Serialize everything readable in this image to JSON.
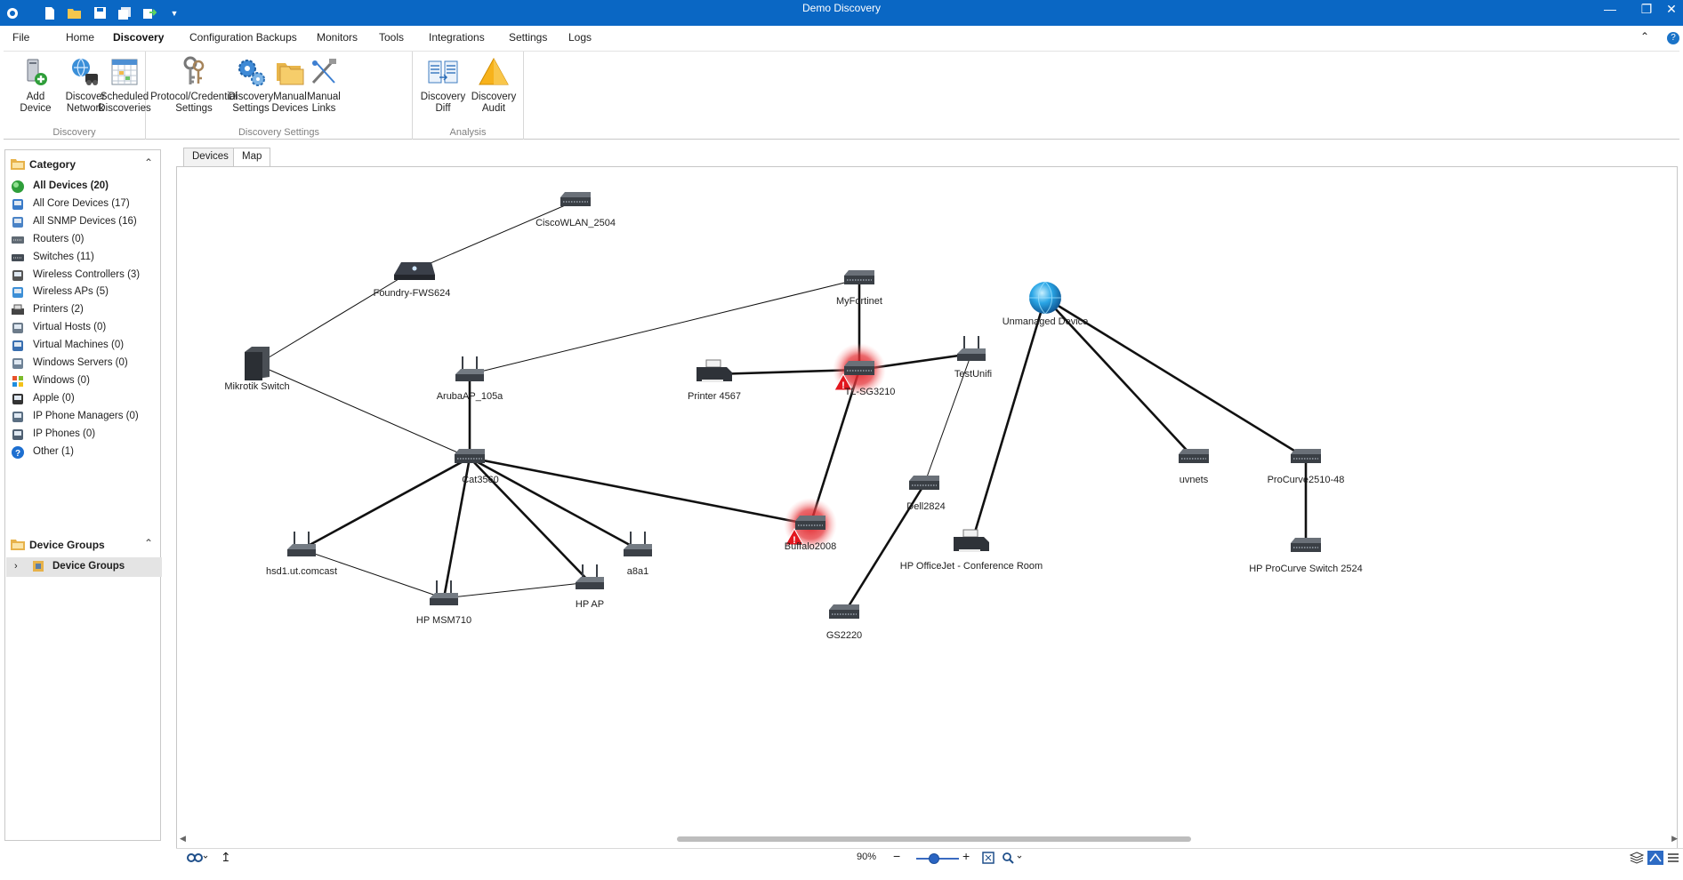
{
  "window": {
    "title": "Demo Discovery",
    "quick_access": [
      "app-icon",
      "new-file-icon",
      "open-folder-icon",
      "save-icon",
      "save-all-icon",
      "export-icon",
      "dropdown-icon"
    ],
    "controls": [
      "minimize-icon",
      "restore-icon",
      "close-icon"
    ]
  },
  "menu": {
    "tabs": [
      {
        "label": "File",
        "active": false
      },
      {
        "label": "Home",
        "active": false
      },
      {
        "label": "Discovery",
        "active": true
      },
      {
        "label": "Configuration Backups",
        "active": false
      },
      {
        "label": "Monitors",
        "active": false
      },
      {
        "label": "Tools",
        "active": false
      },
      {
        "label": "Integrations",
        "active": false
      },
      {
        "label": "Settings",
        "active": false
      },
      {
        "label": "Logs",
        "active": false
      }
    ]
  },
  "ribbon": {
    "groups": [
      {
        "label": "Discovery",
        "buttons": [
          {
            "line1": "Add Device",
            "line2": "",
            "icon": "add-device-icon"
          },
          {
            "line1": "Discover",
            "line2": "Network",
            "icon": "discover-network-icon"
          },
          {
            "line1": "Scheduled",
            "line2": "Discoveries",
            "icon": "scheduled-discoveries-icon"
          }
        ]
      },
      {
        "label": "Discovery Settings",
        "buttons": [
          {
            "line1": "Protocol/Credential",
            "line2": "Settings",
            "icon": "keys-icon"
          },
          {
            "line1": "Discovery",
            "line2": "Settings",
            "icon": "gears-icon"
          },
          {
            "line1": "Manual",
            "line2": "Devices",
            "icon": "folders-icon"
          },
          {
            "line1": "Manual",
            "line2": "Links",
            "icon": "links-icon"
          }
        ]
      },
      {
        "label": "Analysis",
        "buttons": [
          {
            "line1": "Discovery",
            "line2": "Diff",
            "icon": "diff-icon"
          },
          {
            "line1": "Discovery",
            "line2": "Audit",
            "icon": "audit-warning-icon"
          }
        ]
      }
    ]
  },
  "sidebar": {
    "category_title": "Category",
    "categories": [
      {
        "label": "All Devices (20)",
        "icon": "globe-icon",
        "selected": true
      },
      {
        "label": "All Core Devices (17)",
        "icon": "network-tree-icon",
        "selected": false
      },
      {
        "label": "All SNMP Devices (16)",
        "icon": "snmp-monitor-icon",
        "selected": false
      },
      {
        "label": "Routers (0)",
        "icon": "router-icon",
        "selected": false
      },
      {
        "label": "Switches (11)",
        "icon": "switch-icon",
        "selected": false
      },
      {
        "label": "Wireless Controllers (3)",
        "icon": "wireless-controller-icon",
        "selected": false
      },
      {
        "label": "Wireless APs (5)",
        "icon": "wireless-ap-icon",
        "selected": false
      },
      {
        "label": "Printers (2)",
        "icon": "printer-icon",
        "selected": false
      },
      {
        "label": "Virtual Hosts (0)",
        "icon": "virtual-host-icon",
        "selected": false
      },
      {
        "label": "Virtual Machines (0)",
        "icon": "virtual-machine-icon",
        "selected": false
      },
      {
        "label": "Windows Servers (0)",
        "icon": "windows-server-icon",
        "selected": false
      },
      {
        "label": "Windows (0)",
        "icon": "windows-logo-icon",
        "selected": false
      },
      {
        "label": "Apple (0)",
        "icon": "apple-logo-icon",
        "selected": false
      },
      {
        "label": "IP Phone Managers (0)",
        "icon": "ip-phone-manager-icon",
        "selected": false
      },
      {
        "label": "IP Phones (0)",
        "icon": "ip-phone-icon",
        "selected": false
      },
      {
        "label": "Other (1)",
        "icon": "question-icon",
        "selected": false
      }
    ],
    "groups_title": "Device Groups",
    "groups_item": "Device Groups"
  },
  "view_tabs": [
    {
      "label": "Devices",
      "active": false
    },
    {
      "label": "Map",
      "active": true
    }
  ],
  "map": {
    "nodes": [
      {
        "id": "cisco",
        "label": "CiscoWLAN_2504",
        "type": "switch",
        "alert": false
      },
      {
        "id": "foundry",
        "label": "Foundry-FWS624",
        "type": "firewall",
        "alert": false
      },
      {
        "id": "mikrotik",
        "label": "Mikrotik Switch",
        "type": "server",
        "alert": false
      },
      {
        "id": "aruba",
        "label": "ArubaAP_105a",
        "type": "ap",
        "alert": false
      },
      {
        "id": "cat",
        "label": "Cat3560",
        "type": "switch",
        "alert": false
      },
      {
        "id": "myfortinet",
        "label": "MyFortinet",
        "type": "switch",
        "alert": false
      },
      {
        "id": "printer",
        "label": "Printer 4567",
        "type": "printer",
        "alert": false
      },
      {
        "id": "tl",
        "label": "TL-SG3210",
        "type": "switch",
        "alert": true
      },
      {
        "id": "testunifi",
        "label": "TestUnifi",
        "type": "ap",
        "alert": false
      },
      {
        "id": "unmanaged",
        "label": "Unmanaged Device",
        "type": "globe",
        "alert": false
      },
      {
        "id": "dell",
        "label": "Dell2824",
        "type": "switch",
        "alert": false
      },
      {
        "id": "buffalo",
        "label": "Buffalo2008",
        "type": "switch",
        "alert": true
      },
      {
        "id": "hsd",
        "label": "hsd1.ut.comcast",
        "type": "ap",
        "alert": false
      },
      {
        "id": "hpmsm",
        "label": "HP MSM710",
        "type": "ap",
        "alert": false
      },
      {
        "id": "hpap",
        "label": "HP AP",
        "type": "ap",
        "alert": false
      },
      {
        "id": "a8a1",
        "label": "a8a1",
        "type": "ap",
        "alert": false
      },
      {
        "id": "gs2220",
        "label": "GS2220",
        "type": "switch",
        "alert": false
      },
      {
        "id": "hpofficejet",
        "label": "HP OfficeJet - Conference Room",
        "type": "printer",
        "alert": false
      },
      {
        "id": "uvnets",
        "label": "uvnets",
        "type": "switch",
        "alert": false
      },
      {
        "id": "procurve48",
        "label": "ProCurve2510-48",
        "type": "switch",
        "alert": false
      },
      {
        "id": "procurve24",
        "label": "HP ProCurve Switch 2524",
        "type": "switch",
        "alert": false
      }
    ],
    "links": [
      {
        "from": "foundry",
        "to": "cisco",
        "weight": "thin"
      },
      {
        "from": "mikrotik",
        "to": "foundry",
        "weight": "thin"
      },
      {
        "from": "mikrotik",
        "to": "cat",
        "weight": "thin"
      },
      {
        "from": "aruba",
        "to": "myfortinet",
        "weight": "thin"
      },
      {
        "from": "aruba",
        "to": "cat",
        "weight": "thick"
      },
      {
        "from": "cat",
        "to": "hsd",
        "weight": "thick"
      },
      {
        "from": "cat",
        "to": "hpmsm",
        "weight": "thick"
      },
      {
        "from": "cat",
        "to": "hpap",
        "weight": "thick"
      },
      {
        "from": "cat",
        "to": "a8a1",
        "weight": "thick"
      },
      {
        "from": "cat",
        "to": "buffalo",
        "weight": "thick"
      },
      {
        "from": "hsd",
        "to": "hpmsm",
        "weight": "thin"
      },
      {
        "from": "hpmsm",
        "to": "hpap",
        "weight": "thin"
      },
      {
        "from": "myfortinet",
        "to": "tl",
        "weight": "thick"
      },
      {
        "from": "printer",
        "to": "tl",
        "weight": "thick"
      },
      {
        "from": "tl",
        "to": "testunifi",
        "weight": "thick"
      },
      {
        "from": "tl",
        "to": "buffalo",
        "weight": "thick"
      },
      {
        "from": "testunifi",
        "to": "dell",
        "weight": "thin"
      },
      {
        "from": "dell",
        "to": "gs2220",
        "weight": "thick"
      },
      {
        "from": "unmanaged",
        "to": "hpofficejet",
        "weight": "thick"
      },
      {
        "from": "unmanaged",
        "to": "uvnets",
        "weight": "thick"
      },
      {
        "from": "unmanaged",
        "to": "procurve48",
        "weight": "thick"
      },
      {
        "from": "procurve48",
        "to": "procurve24",
        "weight": "thick"
      }
    ]
  },
  "statusbar": {
    "zoom": "90%",
    "zoom_level": 0.5,
    "left_tools": [
      "binoculars-icon",
      "layout-up-icon"
    ],
    "zoom_tools": [
      "zoom-out-icon",
      "zoom-in-icon",
      "fit-to-screen-icon",
      "magnifier-icon"
    ],
    "right_tools": [
      "layers-icon",
      "map-view-icon",
      "list-view-icon"
    ]
  },
  "colors": {
    "titlebar": "#0a67c4",
    "alert": "#d71920",
    "link": "#111111",
    "selected_group": "#e4e4e4"
  }
}
